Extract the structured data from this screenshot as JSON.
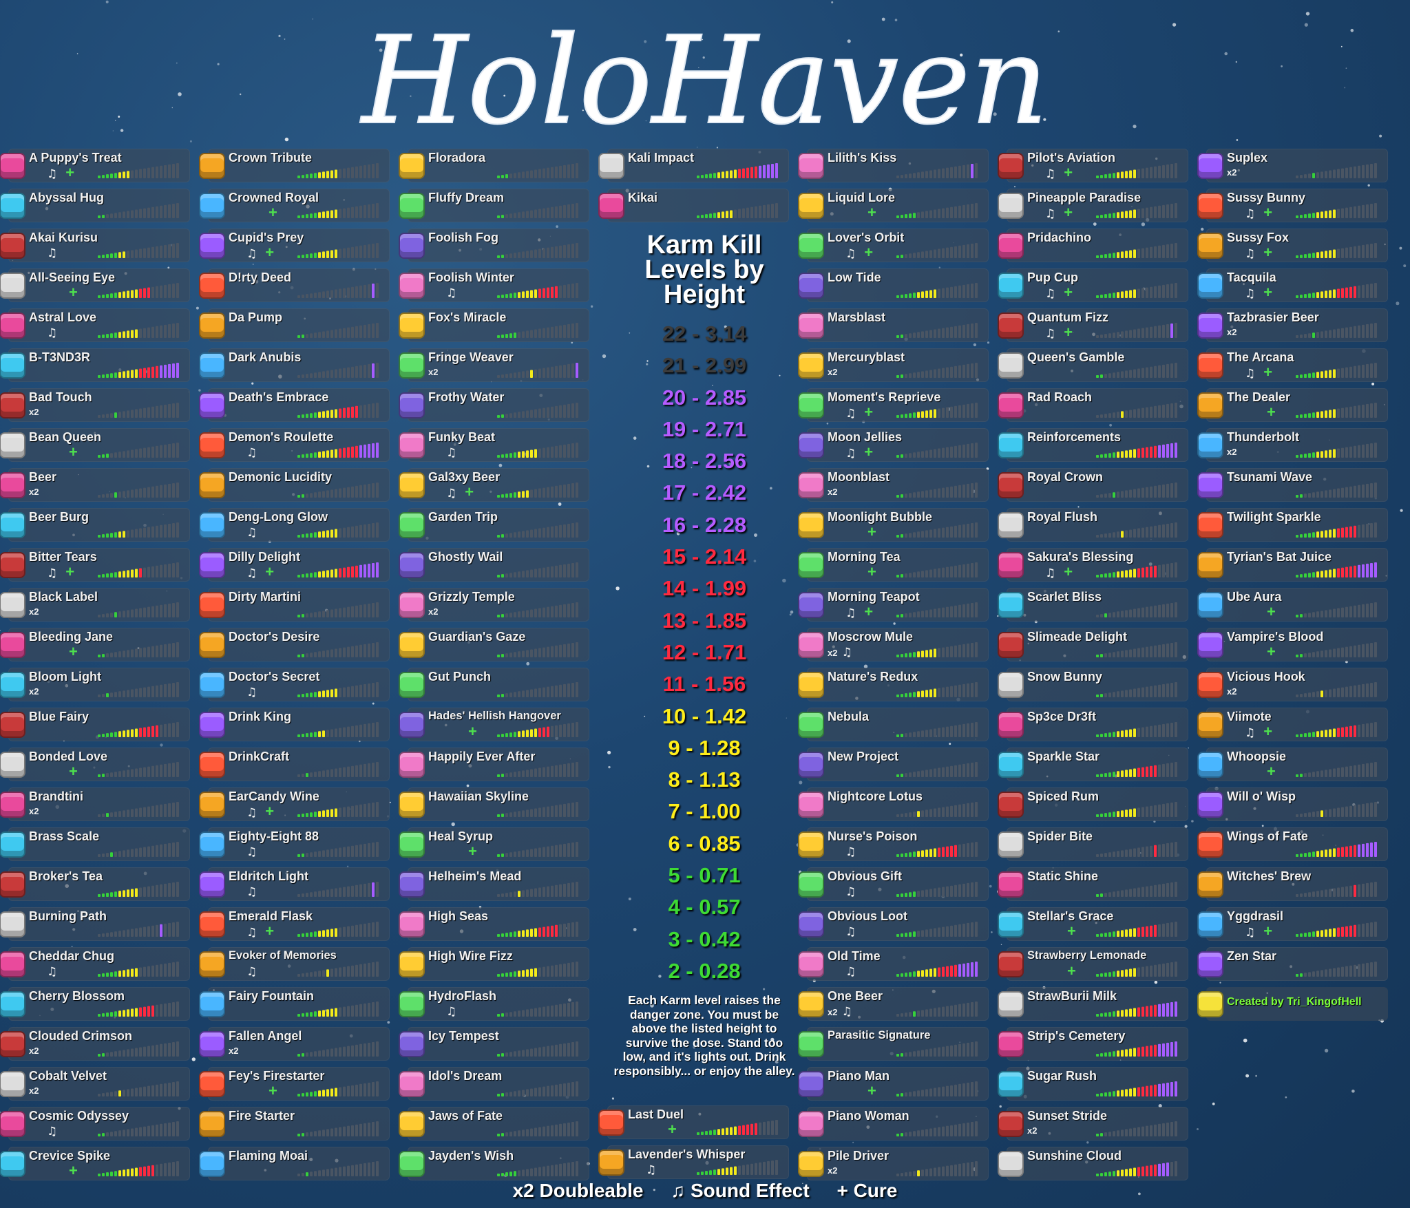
{
  "title": "HoloHaven",
  "chart_title": "Karm Kill Levels by Height",
  "levels": [
    {
      "label": "22 - 3.14",
      "color": "#3c3c3c"
    },
    {
      "label": "21 - 2.99",
      "color": "#3c3c3c"
    },
    {
      "label": "20 - 2.85",
      "color": "#b65cff"
    },
    {
      "label": "19 - 2.71",
      "color": "#b65cff"
    },
    {
      "label": "18 - 2.56",
      "color": "#b65cff"
    },
    {
      "label": "17 - 2.42",
      "color": "#b65cff"
    },
    {
      "label": "16 - 2.28",
      "color": "#b65cff"
    },
    {
      "label": "15 - 2.14",
      "color": "#ff2a40"
    },
    {
      "label": "14 - 1.99",
      "color": "#ff2a40"
    },
    {
      "label": "13 - 1.85",
      "color": "#ff2a40"
    },
    {
      "label": "12 - 1.71",
      "color": "#ff2a40"
    },
    {
      "label": "11 - 1.56",
      "color": "#ff2a40"
    },
    {
      "label": "10 - 1.42",
      "color": "#ffee1a"
    },
    {
      "label": "9 - 1.28",
      "color": "#ffee1a"
    },
    {
      "label": "8 - 1.13",
      "color": "#ffee1a"
    },
    {
      "label": "7 - 1.00",
      "color": "#ffee1a"
    },
    {
      "label": "6 - 0.85",
      "color": "#ffee1a"
    },
    {
      "label": "5 - 0.71",
      "color": "#3edb34"
    },
    {
      "label": "4 - 0.57",
      "color": "#3edb34"
    },
    {
      "label": "3 - 0.42",
      "color": "#3edb34"
    },
    {
      "label": "2 - 0.28",
      "color": "#3edb34"
    }
  ],
  "description": "Each Karm level raises the danger zone. You must be above the listed height to survive the dose. Stand too low, and it's lights out. Drink responsibly... or enjoy the alley.",
  "legend": {
    "doubleable": "x2 Doubleable",
    "sound": "♫ Sound Effect",
    "cure": "+ Cure"
  },
  "credit": "Created by Tri_KingofHell",
  "bar_colors": {
    "green": "#36d13a",
    "yellow": "#f4ea1a",
    "red": "#ff2a40",
    "purple": "#a65cff",
    "empty": "#4a5563"
  },
  "icon_colors": [
    "#e94a9c",
    "#9b5cff",
    "#ffcc33",
    "#3fc9f0",
    "#ff5a3a",
    "#5ee06a",
    "#c83a3a",
    "#f5a623",
    "#7f63e0",
    "#ddd",
    "#49b6ff",
    "#f07ac8"
  ],
  "columns": [
    [
      {
        "name": "A Puppy's Treat",
        "sound": true,
        "cure": true,
        "level": 8
      },
      {
        "name": "Abyssal Hug",
        "level": 2
      },
      {
        "name": "Akai Kurisu",
        "sound": true,
        "level": 7
      },
      {
        "name": "All-Seeing Eye",
        "cure": true,
        "level": 13
      },
      {
        "name": "Astral Love",
        "sound": true,
        "level": 10
      },
      {
        "name": "B-T3ND3R",
        "level": 20
      },
      {
        "name": "Bad Touch",
        "x2": true,
        "level": 5,
        "dot": true
      },
      {
        "name": "Bean Queen",
        "cure": true,
        "level": 3
      },
      {
        "name": "Beer",
        "x2": true,
        "level": 5,
        "dot": true
      },
      {
        "name": "Beer Burg",
        "level": 7
      },
      {
        "name": "Bitter Tears",
        "sound": true,
        "cure": true,
        "level": 11
      },
      {
        "name": "Black Label",
        "x2": true,
        "level": 5,
        "dot": true
      },
      {
        "name": "Bleeding Jane",
        "cure": true,
        "level": 2
      },
      {
        "name": "Bloom Light",
        "x2": true,
        "level": 3,
        "dot": true
      },
      {
        "name": "Blue Fairy",
        "level": 15
      },
      {
        "name": "Bonded Love",
        "cure": true,
        "level": 2
      },
      {
        "name": "Brandtini",
        "x2": true,
        "level": 3,
        "dot": true
      },
      {
        "name": "Brass Scale",
        "level": 4,
        "dot": true
      },
      {
        "name": "Broker's Tea",
        "level": 10
      },
      {
        "name": "Burning Path",
        "level": 16,
        "dot": true
      },
      {
        "name": "Cheddar Chug",
        "sound": true,
        "level": 10
      },
      {
        "name": "Cherry Blossom",
        "level": 14
      },
      {
        "name": "Clouded Crimson",
        "x2": true,
        "level": 2
      },
      {
        "name": "Cobalt Velvet",
        "x2": true,
        "level": 6,
        "dot": true
      },
      {
        "name": "Cosmic Odyssey",
        "sound": true,
        "level": 2
      },
      {
        "name": "Crevice Spike",
        "cure": true,
        "level": 14
      }
    ],
    [
      {
        "name": "Crown Tribute",
        "level": 10
      },
      {
        "name": "Crowned Royal",
        "cure": true,
        "level": 10
      },
      {
        "name": "Cupid's Prey",
        "sound": true,
        "cure": true,
        "level": 10
      },
      {
        "name": "D!rty Deed",
        "level": 19,
        "dot": true
      },
      {
        "name": "Da Pump",
        "level": 2
      },
      {
        "name": "Dark Anubis",
        "level": 19,
        "dot": true
      },
      {
        "name": "Death's Embrace",
        "level": 15
      },
      {
        "name": "Demon's Roulette",
        "sound": true,
        "level": 20
      },
      {
        "name": "Demonic Lucidity",
        "level": 2
      },
      {
        "name": "Deng-Long Glow",
        "sound": true,
        "level": 10
      },
      {
        "name": "Dilly Delight",
        "sound": true,
        "cure": true,
        "level": 20
      },
      {
        "name": "Dirty Martini",
        "level": 2
      },
      {
        "name": "Doctor's Desire",
        "level": 2
      },
      {
        "name": "Doctor's Secret",
        "sound": true,
        "level": 10
      },
      {
        "name": "Drink King",
        "level": 7
      },
      {
        "name": "DrinkCraft",
        "level": 3,
        "dot": true
      },
      {
        "name": "EarCandy Wine",
        "sound": true,
        "cure": true,
        "level": 10
      },
      {
        "name": "Eighty-Eight 88",
        "sound": true,
        "level": 2
      },
      {
        "name": "Eldritch Light",
        "sound": true,
        "level": 19,
        "dot": true
      },
      {
        "name": "Emerald Flask",
        "sound": true,
        "cure": true,
        "level": 10
      },
      {
        "name": "Evoker of Memories",
        "sound": true,
        "level": 8,
        "dot": true,
        "small": true
      },
      {
        "name": "Fairy Fountain",
        "level": 10
      },
      {
        "name": "Fallen Angel",
        "x2": true,
        "level": 2
      },
      {
        "name": "Fey's Firestarter",
        "cure": true,
        "level": 10
      },
      {
        "name": "Fire Starter",
        "level": 2
      },
      {
        "name": "Flaming Moai",
        "level": 3,
        "dot": true
      }
    ],
    [
      {
        "name": "Floradora",
        "level": 3
      },
      {
        "name": "Fluffy Dream",
        "level": 2
      },
      {
        "name": "Foolish Fog",
        "level": 2
      },
      {
        "name": "Foolish Winter",
        "sound": true,
        "level": 15
      },
      {
        "name": "Fox's Miracle",
        "level": 5
      },
      {
        "name": "Fringe Weaver",
        "x2": true,
        "level": 9,
        "dot": true,
        "extra": 20
      },
      {
        "name": "Frothy Water",
        "level": 2
      },
      {
        "name": "Funky Beat",
        "sound": true,
        "level": 10
      },
      {
        "name": "Gal3xy Beer",
        "sound": true,
        "cure": true,
        "level": 8
      },
      {
        "name": "Garden Trip",
        "level": 2
      },
      {
        "name": "Ghostly Wail",
        "level": 2
      },
      {
        "name": "Grizzly Temple",
        "x2": true,
        "level": 2
      },
      {
        "name": "Guardian's Gaze",
        "level": 2
      },
      {
        "name": "Gut Punch",
        "level": 2
      },
      {
        "name": "Hades' Hellish Hangover",
        "cure": true,
        "level": 13,
        "small": true
      },
      {
        "name": "Happily Ever After",
        "level": 2
      },
      {
        "name": "Hawaiian Skyline",
        "level": 2
      },
      {
        "name": "Heal Syrup",
        "cure": true,
        "level": 2
      },
      {
        "name": "Helheim's Mead",
        "level": 6,
        "dot": true
      },
      {
        "name": "High Seas",
        "level": 15
      },
      {
        "name": "High Wire Fizz",
        "level": 10
      },
      {
        "name": "HydroFlash",
        "sound": true,
        "level": 2
      },
      {
        "name": "Icy Tempest",
        "level": 2
      },
      {
        "name": "Idol's Dream",
        "level": 2
      },
      {
        "name": "Jaws of Fate",
        "level": 2
      },
      {
        "name": "Jayden's Wish",
        "level": 5
      }
    ],
    [
      {
        "name": "Kali Impact",
        "level": 20
      },
      {
        "name": "Kikai",
        "level": 9
      }
    ],
    [
      {
        "name": "Last Duel",
        "cure": true,
        "level": 15
      },
      {
        "name": "Lavender's Whisper",
        "sound": true,
        "level": 10
      }
    ],
    [
      {
        "name": "Lilith's Kiss",
        "level": 19,
        "dot": true
      },
      {
        "name": "Liquid Lore",
        "cure": true,
        "level": 5
      },
      {
        "name": "Lover's Orbit",
        "sound": true,
        "cure": true,
        "level": 2
      },
      {
        "name": "Low Tide",
        "level": 10
      },
      {
        "name": "Marsblast",
        "level": 2
      },
      {
        "name": "Mercuryblast",
        "x2": true,
        "level": 2
      },
      {
        "name": "Moment's Reprieve",
        "sound": true,
        "cure": true,
        "level": 10
      },
      {
        "name": "Moon Jellies",
        "sound": true,
        "cure": true,
        "level": 2
      },
      {
        "name": "Moonblast",
        "x2": true,
        "level": 2
      },
      {
        "name": "Moonlight Bubble",
        "cure": true,
        "level": 2
      },
      {
        "name": "Morning Tea",
        "cure": true,
        "level": 2
      },
      {
        "name": "Morning Teapot",
        "sound": true,
        "cure": true,
        "level": 2
      },
      {
        "name": "Moscrow Mule",
        "x2": true,
        "sound": true,
        "level": 10
      },
      {
        "name": "Nature's Redux",
        "level": 10
      },
      {
        "name": "Nebula",
        "level": 2
      },
      {
        "name": "New Project",
        "level": 2
      },
      {
        "name": "Nightcore Lotus",
        "level": 6,
        "dot": true
      },
      {
        "name": "Nurse's Poison",
        "sound": true,
        "level": 15
      },
      {
        "name": "Obvious Gift",
        "sound": true,
        "level": 5
      },
      {
        "name": "Obvious Loot",
        "sound": true,
        "level": 5
      },
      {
        "name": "Old Time",
        "sound": true,
        "level": 20
      },
      {
        "name": "One Beer",
        "x2": true,
        "sound": true,
        "level": 5,
        "dot": true
      },
      {
        "name": "Parasitic Signature",
        "level": 2,
        "small": true
      },
      {
        "name": "Piano Man",
        "cure": true,
        "level": 2
      },
      {
        "name": "Piano Woman",
        "level": 2
      },
      {
        "name": "Pile Driver",
        "x2": true,
        "level": 6,
        "dot": true
      }
    ],
    [
      {
        "name": "Pilot's Aviation",
        "sound": true,
        "cure": true,
        "level": 10
      },
      {
        "name": "Pineapple Paradise",
        "sound": true,
        "cure": true,
        "level": 10
      },
      {
        "name": "Pridachino",
        "level": 10
      },
      {
        "name": "Pup Cup",
        "sound": true,
        "cure": true,
        "level": 10
      },
      {
        "name": "Quantum Fizz",
        "sound": true,
        "cure": true,
        "level": 19,
        "dot": true
      },
      {
        "name": "Queen's Gamble",
        "level": 2
      },
      {
        "name": "Rad Roach",
        "level": 7,
        "dot": true
      },
      {
        "name": "Reinforcements",
        "level": 20
      },
      {
        "name": "Royal Crown",
        "level": 5,
        "dot": true
      },
      {
        "name": "Royal Flush",
        "level": 7,
        "dot": true
      },
      {
        "name": "Sakura's Blessing",
        "sound": true,
        "cure": true,
        "level": 15
      },
      {
        "name": "Scarlet Bliss",
        "level": 3,
        "dot": true
      },
      {
        "name": "Slimeade Delight",
        "level": 2
      },
      {
        "name": "Snow Bunny",
        "level": 2
      },
      {
        "name": "Sp3ce Dr3ft",
        "level": 10
      },
      {
        "name": "Sparkle Star",
        "level": 15
      },
      {
        "name": "Spiced Rum",
        "level": 10
      },
      {
        "name": "Spider Bite",
        "level": 15,
        "dot": true
      },
      {
        "name": "Static Shine",
        "level": 2
      },
      {
        "name": "Stellar's Grace",
        "cure": true,
        "level": 15
      },
      {
        "name": "Strawberry Lemonade",
        "cure": true,
        "level": 10,
        "small": true
      },
      {
        "name": "StrawBurii Milk",
        "level": 20
      },
      {
        "name": "Strip's Cemetery",
        "level": 20
      },
      {
        "name": "Sugar Rush",
        "level": 20
      },
      {
        "name": "Sunset Stride",
        "x2": true,
        "level": 2
      },
      {
        "name": "Sunshine Cloud",
        "level": 18
      }
    ],
    [
      {
        "name": "Suplex",
        "x2": true,
        "level": 5,
        "dot": true
      },
      {
        "name": "Sussy Bunny",
        "sound": true,
        "cure": true,
        "level": 10
      },
      {
        "name": "Sussy Fox",
        "sound": true,
        "cure": true,
        "level": 10
      },
      {
        "name": "Tacquila",
        "sound": true,
        "cure": true,
        "level": 15
      },
      {
        "name": "Tazbrasier Beer",
        "x2": true,
        "level": 5,
        "dot": true
      },
      {
        "name": "The Arcana",
        "sound": true,
        "cure": true,
        "level": 10
      },
      {
        "name": "The Dealer",
        "cure": true,
        "level": 10
      },
      {
        "name": "Thunderbolt",
        "x2": true,
        "level": 10
      },
      {
        "name": "Tsunami Wave",
        "level": 2
      },
      {
        "name": "Twilight Sparkle",
        "level": 15
      },
      {
        "name": "Tyrian's Bat Juice",
        "level": 20
      },
      {
        "name": "Ube Aura",
        "cure": true,
        "level": 2
      },
      {
        "name": "Vampire's Blood",
        "cure": true,
        "level": 2
      },
      {
        "name": "Vicious Hook",
        "x2": true,
        "level": 7,
        "dot": true
      },
      {
        "name": "Viimote",
        "sound": true,
        "cure": true,
        "level": 15
      },
      {
        "name": "Whoopsie",
        "cure": true,
        "level": 2
      },
      {
        "name": "Will o' Wisp",
        "level": 7,
        "dot": true
      },
      {
        "name": "Wings of Fate",
        "level": 20
      },
      {
        "name": "Witches' Brew",
        "level": 15,
        "dot": true
      },
      {
        "name": "Yggdrasil",
        "sound": true,
        "cure": true,
        "level": 15
      },
      {
        "name": "Zen Star",
        "level": 2
      }
    ]
  ]
}
